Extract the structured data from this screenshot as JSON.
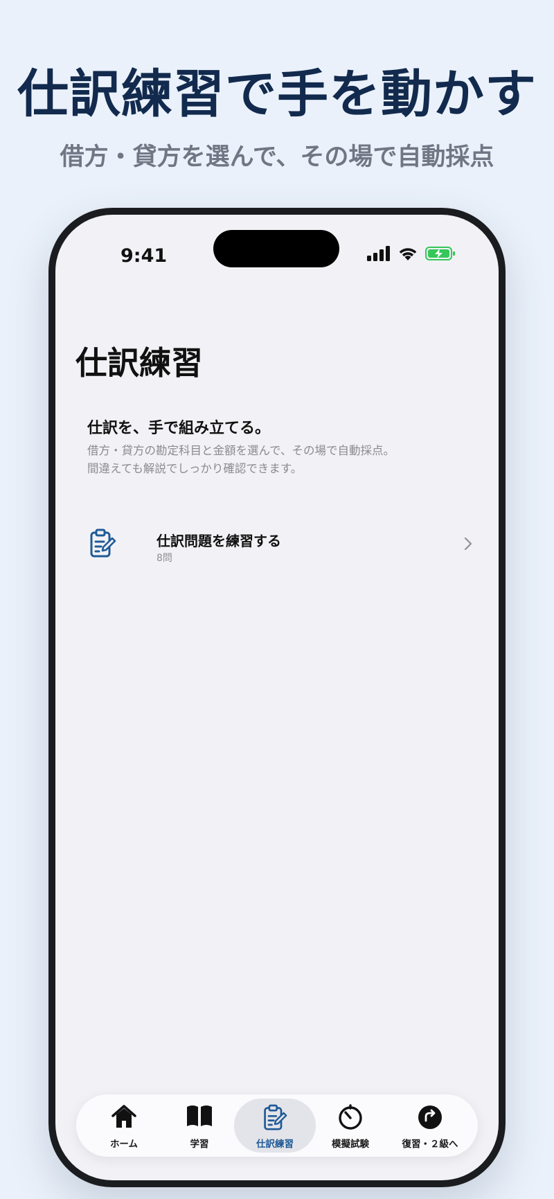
{
  "promo": {
    "headline": "仕訳練習で手を動かす",
    "subline": "借方・貸方を選んで、その場で自動採点"
  },
  "status_bar": {
    "time": "9:41"
  },
  "screen": {
    "title": "仕訳練習",
    "intro_title": "仕訳を、手で組み立てる。",
    "intro_body_line1": "借方・貸方の勘定科目と金額を選んで、その場で自動採点。",
    "intro_body_line2": "間違えても解説でしっかり確認できます。",
    "practice_item": {
      "title": "仕訳問題を練習する",
      "subtitle": "8問"
    }
  },
  "tab_bar": {
    "tabs": [
      {
        "label": "ホーム",
        "icon": "house-icon"
      },
      {
        "label": "学習",
        "icon": "book-icon"
      },
      {
        "label": "仕訳練習",
        "icon": "clipboard-pencil-icon",
        "active": true
      },
      {
        "label": "模擬試験",
        "icon": "timer-icon"
      },
      {
        "label": "復習・２級へ",
        "icon": "arrow-up-circle-icon"
      }
    ]
  },
  "colors": {
    "background": "#eaf1fa",
    "headline": "#122a4d",
    "accent": "#1f5a96",
    "battery": "#34c759"
  }
}
